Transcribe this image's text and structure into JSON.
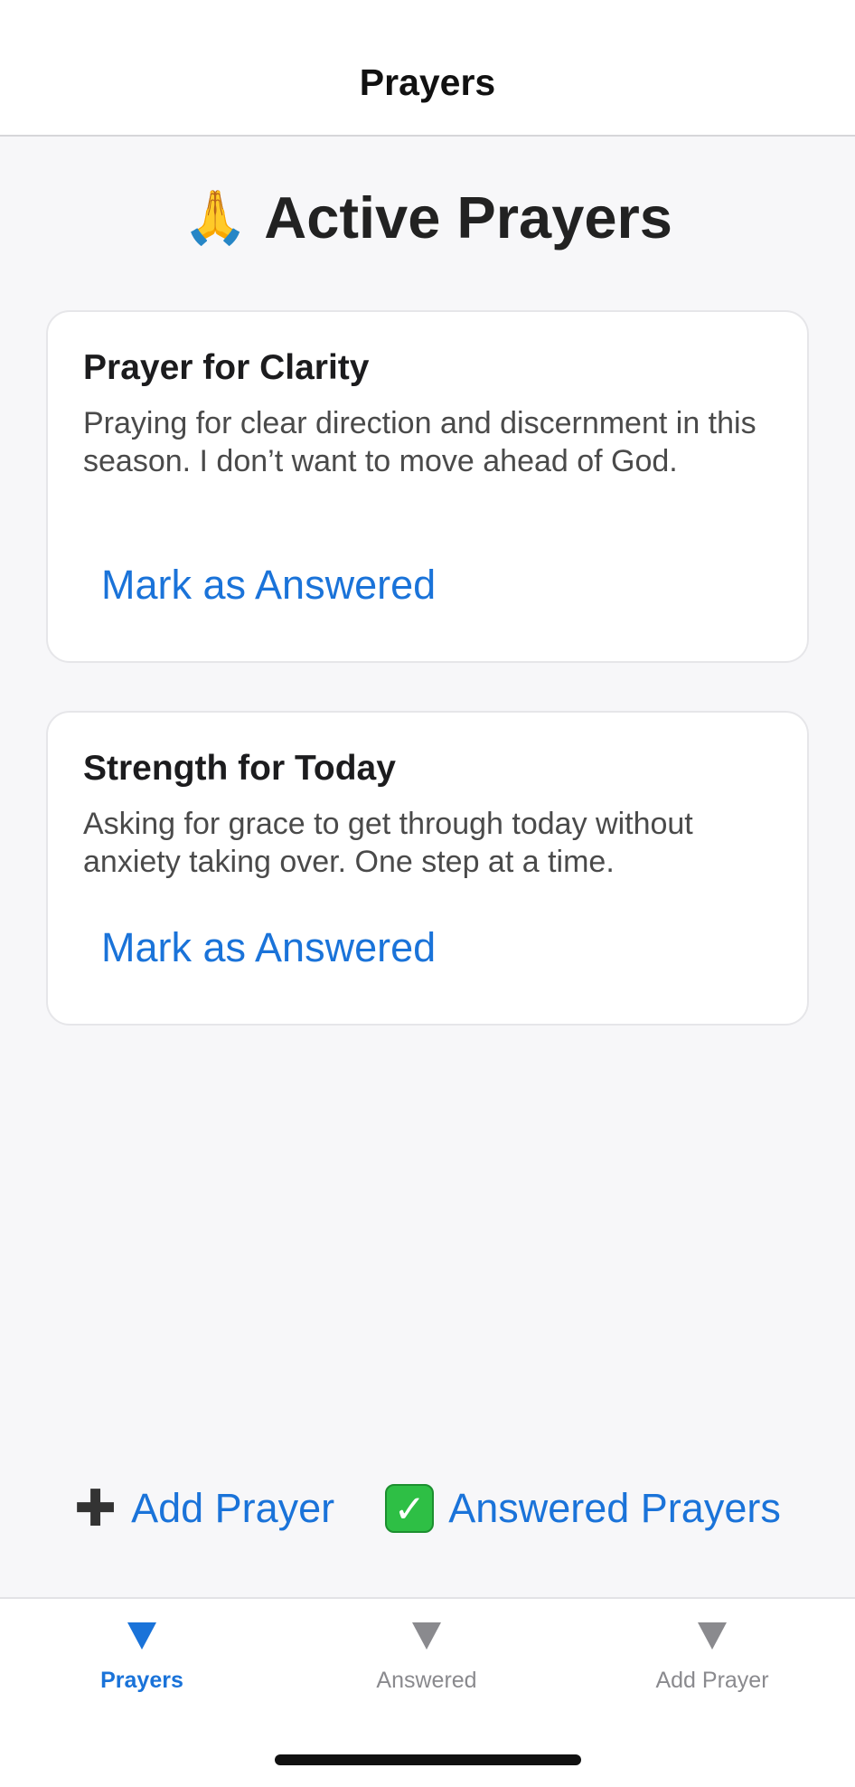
{
  "navbar": {
    "title": "Prayers"
  },
  "page": {
    "heading": "Active Prayers",
    "heading_emoji": "🙏"
  },
  "prayers": [
    {
      "title": "Prayer for Clarity",
      "text": "Praying for clear direction and discernment in this season. I don’t want to move ahead of God.",
      "button": "Mark as Answered"
    },
    {
      "title": "Strength for Today",
      "text": "Asking for grace to get through today without anxiety taking over. One step at a time.",
      "button": "Mark as Answered"
    }
  ],
  "actions": {
    "add_prayer": {
      "label": "Add Prayer",
      "icon": "plus-icon"
    },
    "answered_prayers": {
      "label": "Answered Prayers",
      "icon": "check-mark-icon"
    }
  },
  "tabs": [
    {
      "label": "Prayers",
      "icon": "triangle-down-icon",
      "active": true
    },
    {
      "label": "Answered",
      "icon": "triangle-down-icon",
      "active": false
    },
    {
      "label": "Add Prayer",
      "icon": "triangle-down-icon",
      "active": false
    }
  ],
  "colors": {
    "accent": "#1a73d9",
    "inactive_tab": "#8a8a8e",
    "background": "#f7f7f9",
    "check_green": "#2ebf45"
  }
}
